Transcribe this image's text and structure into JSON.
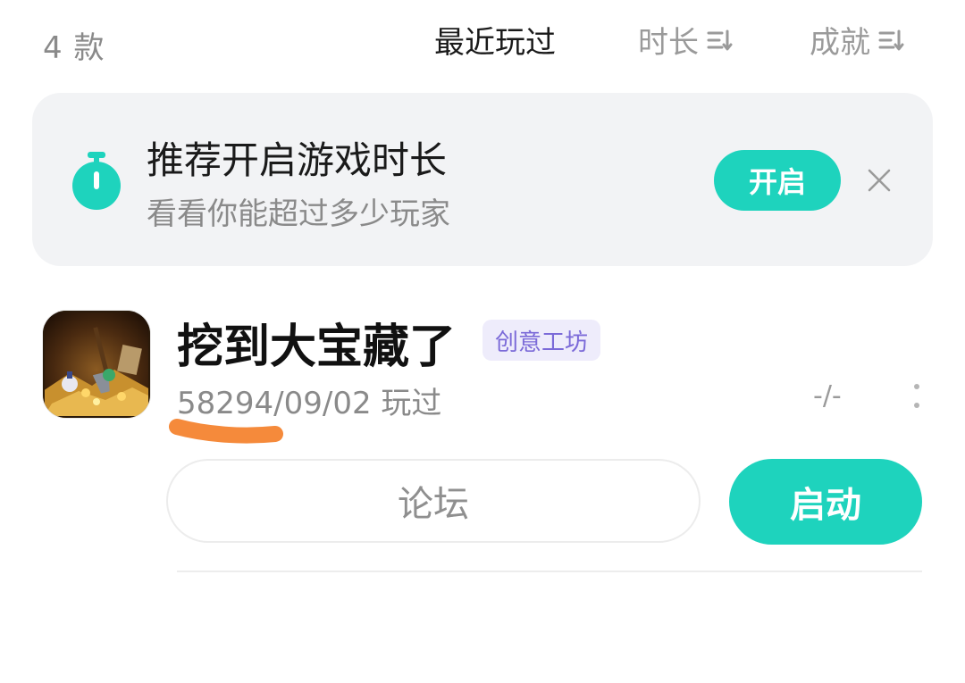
{
  "header": {
    "count": "4 款",
    "sort_tabs": [
      {
        "label": "最近玩过",
        "active": true
      },
      {
        "label": "时长",
        "active": false,
        "icon": "sort-icon"
      },
      {
        "label": "成就",
        "active": false,
        "icon": "sort-icon"
      }
    ]
  },
  "banner": {
    "icon": "timer-icon",
    "title": "推荐开启游戏时长",
    "subtitle": "看看你能超过多少玩家",
    "action_label": "开启",
    "close_icon": "close-icon"
  },
  "game": {
    "title": "挖到大宝藏了",
    "tag": "创意工坊",
    "last_played": "58294/09/02 玩过",
    "duration": "-/-",
    "more_icon": "more-vertical-icon",
    "forum_label": "论坛",
    "launch_label": "启动"
  },
  "colors": {
    "accent": "#1ed3bd",
    "tag_bg": "#eeecfb",
    "tag_text": "#7b6ad8",
    "banner_bg": "#f2f3f5",
    "annotation": "#f58a3b"
  }
}
